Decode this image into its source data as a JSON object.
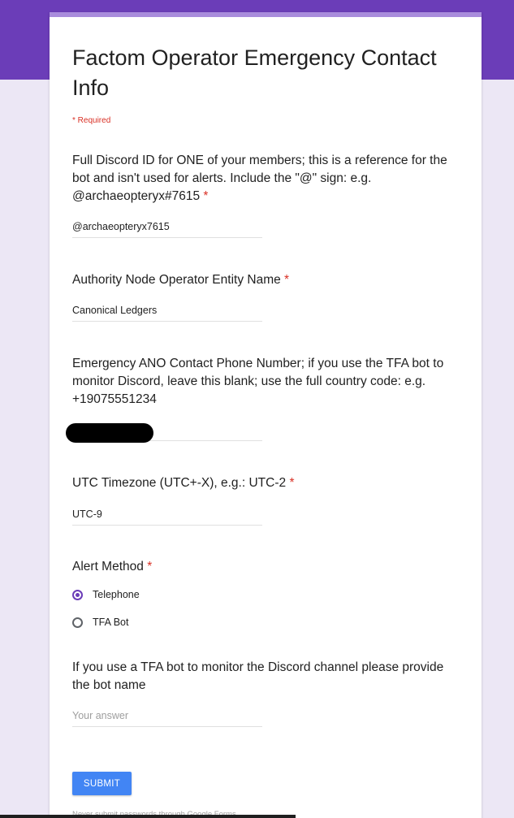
{
  "form": {
    "title": "Factom Operator Emergency Contact Info",
    "required_note": "* Required",
    "asterisk": "*",
    "questions": [
      {
        "label": "Full Discord ID for ONE of your members; this is a reference for the bot and isn't used for alerts. Include the \"@\" sign: e.g. @archaeopteryx#7615",
        "required": true,
        "value": "@archaeopteryx7615"
      },
      {
        "label": "Authority Node Operator Entity Name",
        "required": true,
        "value": "Canonical Ledgers"
      },
      {
        "label": "Emergency ANO Contact Phone Number; if you use the TFA bot to monitor Discord, leave this blank; use the full country code: e.g. +19075551234",
        "required": false,
        "value": ""
      },
      {
        "label": "UTC Timezone (UTC+-X), e.g.: UTC-2",
        "required": true,
        "value": "UTC-9"
      },
      {
        "label": "Alert Method",
        "required": true,
        "options": [
          {
            "label": "Telephone",
            "selected": true
          },
          {
            "label": "TFA Bot",
            "selected": false
          }
        ]
      },
      {
        "label": "If you use a TFA bot to monitor the Discord channel please provide the bot name",
        "required": false,
        "placeholder": "Your answer"
      }
    ],
    "submit_label": "SUBMIT",
    "footer_note": "Never submit passwords through Google Forms."
  },
  "colors": {
    "header_purple": "#6b3db8",
    "accent_lavender": "#a98cdc",
    "background": "#ece7f5",
    "required_red": "#d93025",
    "submit_blue": "#4285f4"
  }
}
